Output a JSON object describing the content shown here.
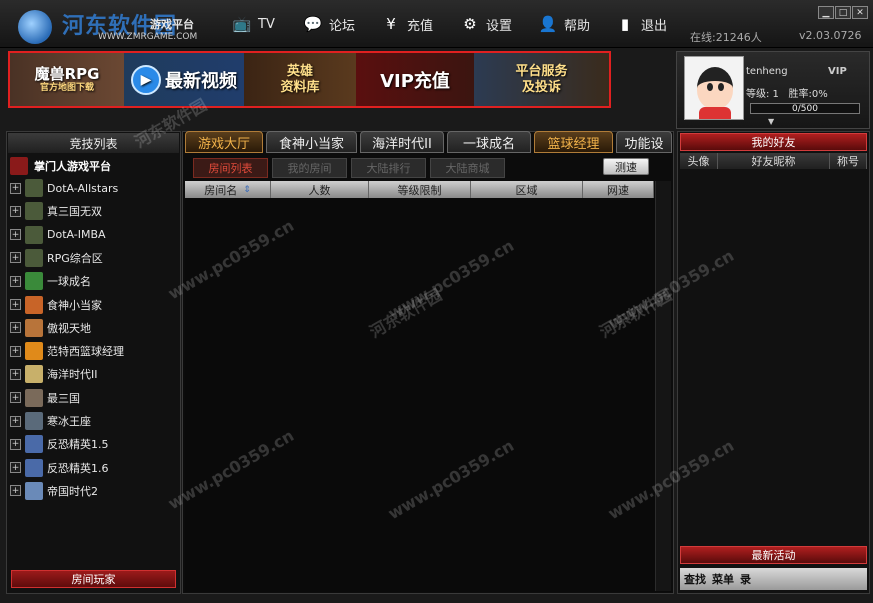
{
  "app": {
    "logo_text": "河东软件园",
    "logo_brand": "游戏平台",
    "logo_url": "WWW.ZMRGAME.COM",
    "watermark_url": "www.pc0359.cn"
  },
  "topmenu": {
    "tv": "TV",
    "forum": "论坛",
    "recharge": "充值",
    "settings": "设置",
    "help": "帮助",
    "exit": "退出"
  },
  "status": {
    "online": "在线:21246人",
    "version": "v2.03.0726"
  },
  "banner": {
    "rpg_title": "魔兽RPG",
    "rpg_sub": "官方地图下载",
    "video": "最新视频",
    "hero_line1": "英雄",
    "hero_line2": "资料库",
    "vip": "VIP充值",
    "service_line1": "平台服务",
    "service_line2": "及投诉"
  },
  "user": {
    "name": "tenheng",
    "vip": "VIP",
    "level": "等级: 1",
    "winrate": "胜率:0%",
    "exp": "0/500"
  },
  "left": {
    "header": "竞技列表",
    "platform": "掌门人游戏平台",
    "items": [
      {
        "label": "DotA-Allstars",
        "color": "#4b5a3a"
      },
      {
        "label": "真三国无双",
        "color": "#4b5a3a"
      },
      {
        "label": "DotA-IMBA",
        "color": "#4b5a3a"
      },
      {
        "label": "RPG综合区",
        "color": "#4b5a3a"
      },
      {
        "label": "一球成名",
        "color": "#3a8a3a"
      },
      {
        "label": "食神小当家",
        "color": "#c86428"
      },
      {
        "label": "傲视天地",
        "color": "#b8743a"
      },
      {
        "label": "范特西篮球经理",
        "color": "#e08a1a"
      },
      {
        "label": "海洋时代II",
        "color": "#c8b06a"
      },
      {
        "label": "最三国",
        "color": "#7a6a5a"
      },
      {
        "label": "寒冰王座",
        "color": "#5a6a7a"
      },
      {
        "label": "反恐精英1.5",
        "color": "#4a6aa8"
      },
      {
        "label": "反恐精英1.6",
        "color": "#4a6aa8"
      },
      {
        "label": "帝国时代2",
        "color": "#6a8ab8"
      }
    ],
    "footer": "房间玩家"
  },
  "center": {
    "tabs": [
      "游戏大厅",
      "食神小当家",
      "海洋时代II",
      "一球成名",
      "篮球经理",
      "功能设"
    ],
    "subtabs": [
      "房间列表",
      "我的房间",
      "大陆排行",
      "大陆商城"
    ],
    "speedtest": "测速",
    "columns": [
      "房间名",
      "人数",
      "等级限制",
      "区域",
      "网速"
    ]
  },
  "right": {
    "header": "我的好友",
    "columns": [
      "头像",
      "好友昵称",
      "称号"
    ],
    "latest": "最新活动",
    "bottom": [
      "查找",
      "菜单",
      "录"
    ]
  }
}
